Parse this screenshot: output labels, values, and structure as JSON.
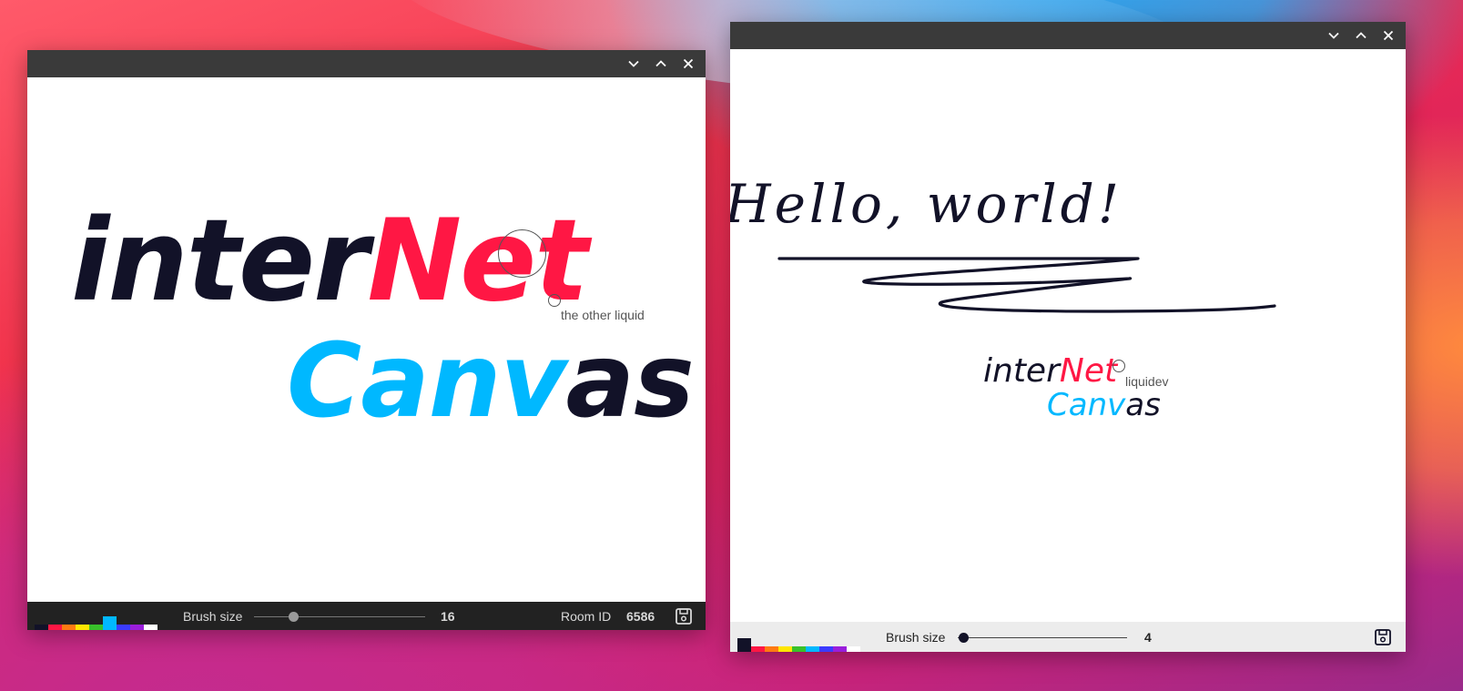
{
  "wallpaper": {
    "name": "macos-big-sur"
  },
  "colors": {
    "ink": "#121228",
    "red": "#ff1744",
    "cyan": "#00b8ff",
    "palette": [
      "#121228",
      "#ff1744",
      "#ff7a12",
      "#ffe600",
      "#39c12a",
      "#00b8ff",
      "#3b3bff",
      "#9a1edb",
      "#ffffff"
    ]
  },
  "window1": {
    "controls": {
      "minimize_icon": "chevron-down-icon",
      "maximize_icon": "chevron-up-icon",
      "close_icon": "close-icon"
    },
    "canvas": {
      "drawing_line1_part1": "inter",
      "drawing_line1_part2": "Net",
      "drawing_line2_part1": "Canv",
      "drawing_line2_part2": "as",
      "other_user_label": "the other liquid"
    },
    "toolbar": {
      "selected_color_index": 5,
      "brush_size_label": "Brush size",
      "brush_size_value": "16",
      "brush_size_fraction": 0.23,
      "room_id_label": "Room ID",
      "room_id_value": "6586",
      "save_icon": "save-icon"
    }
  },
  "window2": {
    "controls": {
      "minimize_icon": "chevron-down-icon",
      "maximize_icon": "chevron-up-icon",
      "close_icon": "close-icon"
    },
    "canvas": {
      "greeting": "Hello, world!",
      "drawing_line1_part1": "inter",
      "drawing_line1_part2": "Net",
      "drawing_line2_part1": "Canv",
      "drawing_line2_part2": "as",
      "other_user_label": "liquidev"
    },
    "toolbar": {
      "selected_color_index": 0,
      "brush_size_label": "Brush size",
      "brush_size_value": "4",
      "brush_size_fraction": 0.03,
      "save_icon": "save-icon"
    }
  }
}
